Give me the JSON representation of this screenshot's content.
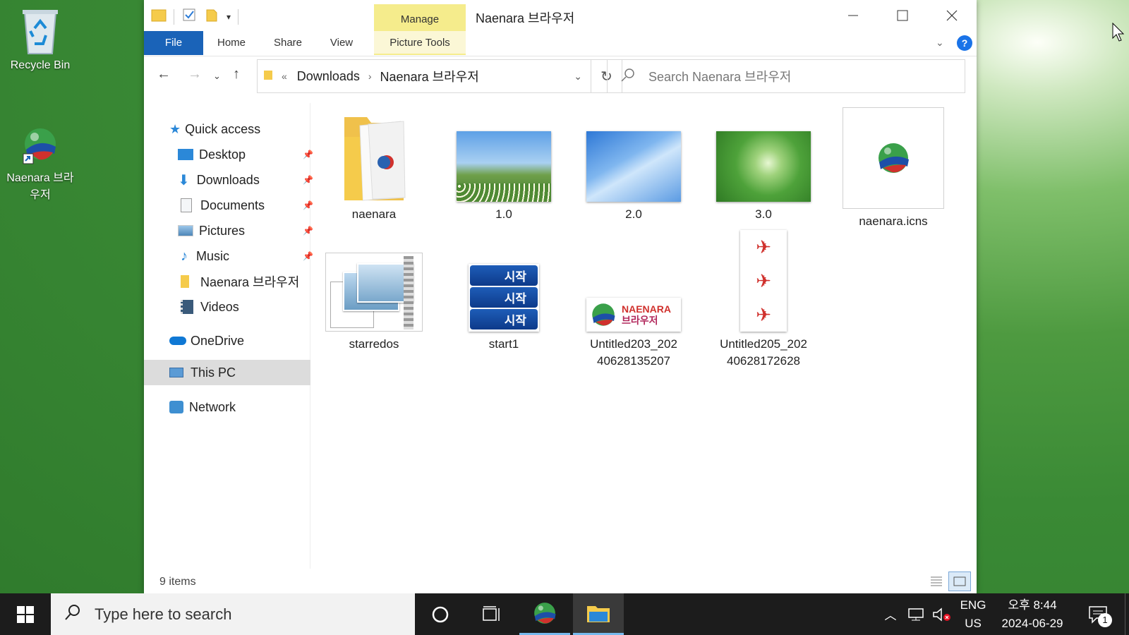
{
  "desktop": {
    "icons": [
      {
        "label": "Recycle Bin"
      },
      {
        "label": "Naenara 브라우저"
      }
    ]
  },
  "window": {
    "title": "Naenara 브라우저",
    "manage_tab": "Manage",
    "ribbon_tabs": [
      "File",
      "Home",
      "Share",
      "View",
      "Picture Tools"
    ],
    "address": {
      "chevron": "«",
      "path": [
        "Downloads",
        "Naenara 브라우저"
      ]
    },
    "search_placeholder": "Search Naenara 브라우저",
    "nav": {
      "quick_access": "Quick access",
      "pinned": [
        {
          "label": "Desktop",
          "icon": "desktop-icon"
        },
        {
          "label": "Downloads",
          "icon": "downloads-icon"
        },
        {
          "label": "Documents",
          "icon": "documents-icon"
        },
        {
          "label": "Pictures",
          "icon": "pictures-icon"
        },
        {
          "label": "Music",
          "icon": "music-icon"
        }
      ],
      "other": [
        {
          "label": "Naenara 브라우저",
          "icon": "folder-icon"
        },
        {
          "label": "Videos",
          "icon": "videos-icon"
        }
      ],
      "onedrive": "OneDrive",
      "this_pc": "This PC",
      "network": "Network"
    },
    "files": [
      {
        "name": "naenara",
        "type": "folder"
      },
      {
        "name": "1.0",
        "type": "image"
      },
      {
        "name": "2.0",
        "type": "image"
      },
      {
        "name": "3.0",
        "type": "image"
      },
      {
        "name": "naenara.icns",
        "type": "icns"
      },
      {
        "name": "starredos",
        "type": "zip"
      },
      {
        "name": "start1",
        "type": "image"
      },
      {
        "name": "Untitled203_202\n40628135207",
        "type": "image"
      },
      {
        "name": "Untitled205_202\n40628172628",
        "type": "image"
      }
    ],
    "thumb_texts": {
      "start_label": "시작",
      "naenara_brand": "NAENARA",
      "naenara_korean": "브라우저"
    },
    "status": "9 items"
  },
  "taskbar": {
    "search_placeholder": "Type here to search",
    "lang_top": "ENG",
    "lang_bottom": "US",
    "time": "오후 8:44",
    "date": "2024-06-29",
    "notification_count": "1"
  },
  "colors": {
    "accent": "#1a63b8",
    "manage_tab": "#f5ec8c",
    "taskbar": "#1c1c1c"
  }
}
